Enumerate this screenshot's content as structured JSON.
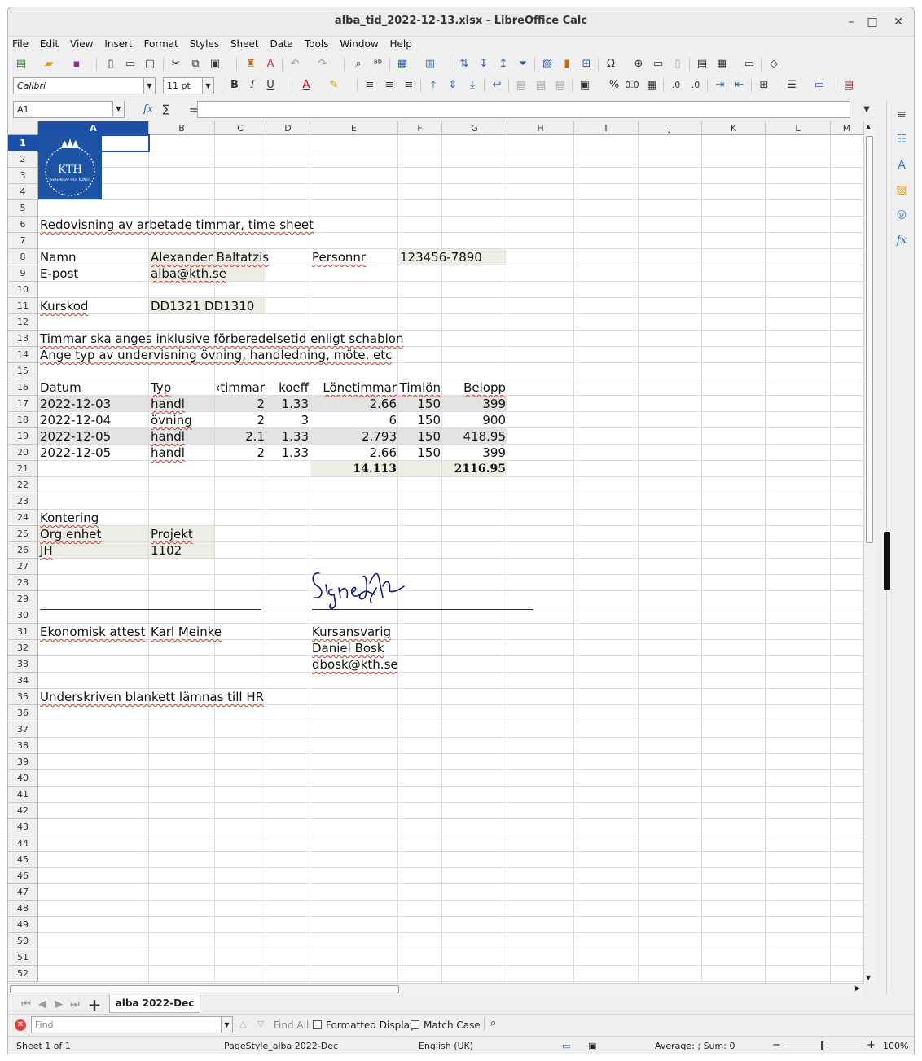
{
  "window": {
    "title": "alba_tid_2022-12-13.xlsx - LibreOffice Calc",
    "minimize": "–",
    "maximize": "□",
    "close": "✕"
  },
  "menu": [
    "File",
    "Edit",
    "View",
    "Insert",
    "Format",
    "Styles",
    "Sheet",
    "Data",
    "Tools",
    "Window",
    "Help"
  ],
  "format": {
    "font_name": "Calibri",
    "font_size": "11 pt"
  },
  "formula": {
    "cell_ref": "A1",
    "fx": "fx",
    "sigma": "∑",
    "equals": "=",
    "content": ""
  },
  "columns": [
    "A",
    "B",
    "C",
    "D",
    "E",
    "F",
    "G",
    "H",
    "I",
    "J",
    "K",
    "L",
    "M"
  ],
  "rows_count": 52,
  "logo": {
    "text": "KTH",
    "subtext": "VETENSKAP OCH KONST"
  },
  "sheet": {
    "r6": "Redovisning av arbetade timmar, time sheet",
    "name_label": "Namn",
    "name_value": "Alexander Baltatzis",
    "personnr_label": "Personnr",
    "personnr_value": "123456-7890",
    "email_label": "E-post",
    "email_value": "alba@kth.se",
    "kurskod_label": "Kurskod",
    "kurskod_value": "DD1321 DD1310",
    "r13": "Timmar ska anges inklusive förberedelsetid enligt schablon",
    "r14": "Ange typ av undervisning övning, handledning, möte, etc",
    "headers": [
      "Datum",
      "Typ",
      "‹timmar",
      "koeff",
      "Lönetimmar",
      "Timlön",
      "Belopp"
    ],
    "rows": [
      [
        "2022-12-03",
        "handl",
        "2",
        "1.33",
        "2.66",
        "150",
        "399"
      ],
      [
        "2022-12-04",
        "övning",
        "2",
        "3",
        "6",
        "150",
        "900"
      ],
      [
        "2022-12-05",
        "handl",
        "2.1",
        "1.33",
        "2.793",
        "150",
        "418.95"
      ],
      [
        "2022-12-05",
        "handl",
        "2",
        "1.33",
        "2.66",
        "150",
        "399"
      ]
    ],
    "total_hours": "14.113",
    "total_amount": "2116.95",
    "kontering": "Kontering",
    "org_label": "Org.enhet",
    "projekt_label": "Projekt",
    "org_value": "JH",
    "projekt_value": "1102",
    "signature": "Signed by Me",
    "attest_label": "Ekonomisk attest",
    "attest_name": "Karl Meinke",
    "kursansvarig_label": "Kursansvarig",
    "kursansvarig_name": "Daniel Bosk",
    "kursansvarig_email": "dbosk@kth.se",
    "r35": "Underskriven blankett lämnas till HR"
  },
  "tabs": {
    "sheet_tab": "alba 2022-Dec",
    "add": "+"
  },
  "find": {
    "placeholder": "Find",
    "find_all": "Find All",
    "formatted_display": "Formatted Display",
    "match_case": "Match Case"
  },
  "status": {
    "sheet": "Sheet 1 of 1",
    "page_style": "PageStyle_alba 2022-Dec",
    "language": "English (UK)",
    "sum": "Average: ; Sum: 0",
    "zoom": "100%",
    "zoom_minus": "−",
    "zoom_plus": "+"
  },
  "colors": {
    "selection": "#1b4fa8",
    "input_shade": "#eeede5",
    "logo_blue": "#1d54a6"
  }
}
